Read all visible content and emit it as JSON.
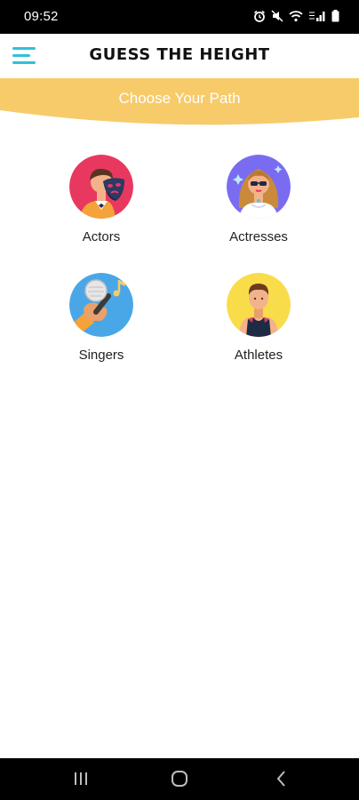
{
  "status_bar": {
    "time": "09:52",
    "icons": [
      "alarm-icon",
      "mute-icon",
      "wifi-icon",
      "lte-signal-icon",
      "battery-icon"
    ]
  },
  "header": {
    "title": "GUESS THE HEIGHT",
    "menu_icon": "hamburger-menu-icon",
    "accent_color": "#2fc1d7"
  },
  "banner": {
    "text": "Choose Your Path",
    "color": "#f7cb6a"
  },
  "categories": [
    {
      "label": "Actors",
      "icon": "actor-theatre-mask-icon",
      "bg_color": "#e9385f"
    },
    {
      "label": "Actresses",
      "icon": "actress-sunglasses-icon",
      "bg_color": "#7a6cf0"
    },
    {
      "label": "Singers",
      "icon": "microphone-hand-icon",
      "bg_color": "#49a7e7"
    },
    {
      "label": "Athletes",
      "icon": "athlete-tank-top-icon",
      "bg_color": "#f9dc4a"
    }
  ],
  "nav_bar": {
    "buttons": [
      "recent-apps-icon",
      "home-icon",
      "back-icon"
    ]
  }
}
